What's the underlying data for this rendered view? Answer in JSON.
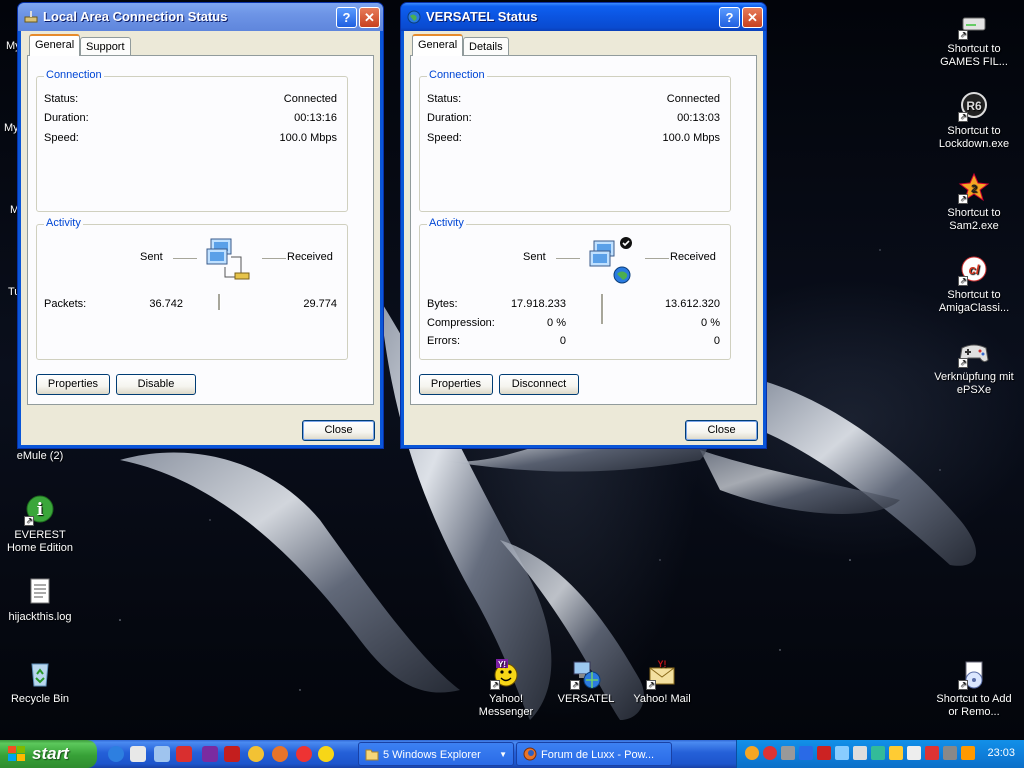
{
  "desktop": {
    "partial_labels": [
      "My",
      "My",
      "M",
      "Tu"
    ],
    "left_icons": [
      {
        "label": "eMule (2)",
        "icon": "emule-icon"
      },
      {
        "label": "EVEREST Home Edition",
        "icon": "everest-info-icon"
      },
      {
        "label": "hijackthis.log",
        "icon": "text-document-icon"
      },
      {
        "label": "Recycle Bin",
        "icon": "recycle-bin-icon"
      }
    ],
    "bottom_icons": [
      {
        "label": "Yahoo! Messenger",
        "icon": "yahoo-messenger-icon"
      },
      {
        "label": "VERSATEL",
        "icon": "network-connection-icon"
      },
      {
        "label": "Yahoo! Mail",
        "icon": "yahoo-mail-icon"
      }
    ],
    "right_icons": [
      {
        "label": "Shortcut to GAMES FIL...",
        "icon": "drive-icon"
      },
      {
        "label": "Shortcut to Lockdown.exe",
        "icon": "r6-icon"
      },
      {
        "label": "Shortcut to Sam2.exe",
        "icon": "sam2-icon"
      },
      {
        "label": "Shortcut to AmigaClassi...",
        "icon": "amiga-icon"
      },
      {
        "label": "Verknüpfung mit ePSXe",
        "icon": "gamepad-icon"
      },
      {
        "label": "Shortcut to Add or Remo...",
        "icon": "add-remove-programs-icon"
      }
    ]
  },
  "lan_window": {
    "title": "Local Area Connection Status",
    "help_label": "?",
    "close_x": "✕",
    "tabs": [
      "General",
      "Support"
    ],
    "connection_legend": "Connection",
    "status_label": "Status:",
    "status_value": "Connected",
    "duration_label": "Duration:",
    "duration_value": "00:13:16",
    "speed_label": "Speed:",
    "speed_value": "100.0 Mbps",
    "activity_legend": "Activity",
    "sent_label": "Sent",
    "received_label": "Received",
    "packets_label": "Packets:",
    "packets_sent": "36.742",
    "packets_received": "29.774",
    "properties_button": "Properties",
    "disable_button": "Disable",
    "close_button": "Close"
  },
  "versatel_window": {
    "title": "VERSATEL Status",
    "help_label": "?",
    "close_x": "✕",
    "tabs": [
      "General",
      "Details"
    ],
    "connection_legend": "Connection",
    "status_label": "Status:",
    "status_value": "Connected",
    "duration_label": "Duration:",
    "duration_value": "00:13:03",
    "speed_label": "Speed:",
    "speed_value": "100.0 Mbps",
    "activity_legend": "Activity",
    "sent_label": "Sent",
    "received_label": "Received",
    "bytes_label": "Bytes:",
    "bytes_sent": "17.918.233",
    "bytes_received": "13.612.320",
    "compression_label": "Compression:",
    "compression_sent": "0 %",
    "compression_received": "0 %",
    "errors_label": "Errors:",
    "errors_sent": "0",
    "errors_received": "0",
    "properties_button": "Properties",
    "disconnect_button": "Disconnect",
    "close_button": "Close"
  },
  "taskbar": {
    "start_label": "start",
    "quick_launch": [
      "ie-icon",
      "media-player-icon",
      "show-desktop-icon",
      "app-icon",
      "app-icon",
      "app-icon",
      "app-icon",
      "firefox-icon",
      "app-icon"
    ],
    "items": [
      {
        "label": "5 Windows Explorer",
        "icon": "folder-icon"
      },
      {
        "label": "Forum de Luxx - Pow...",
        "icon": "firefox-icon"
      }
    ],
    "clock": "23:03",
    "colors": {
      "taskbar": "#245edb",
      "start": "#3a9d3a",
      "tray": "#0f84e0"
    }
  }
}
